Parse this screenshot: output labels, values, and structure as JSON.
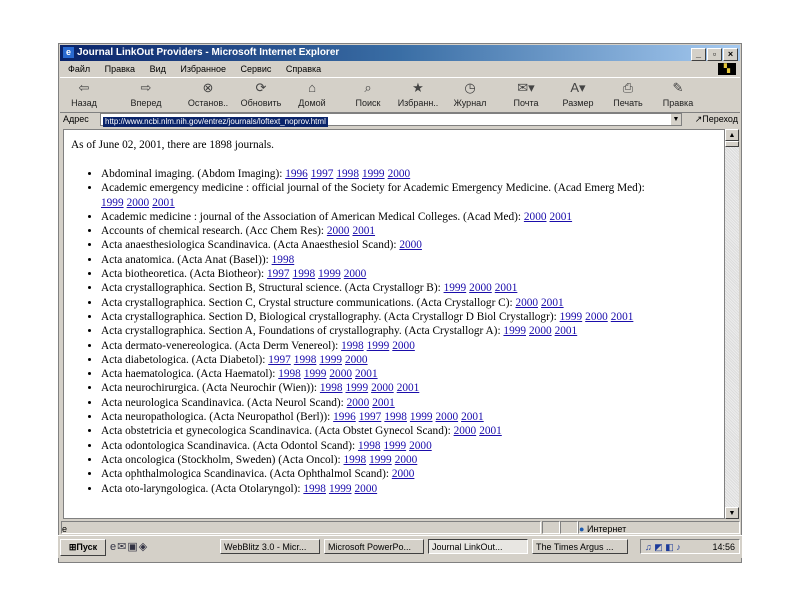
{
  "window": {
    "title": "Journal LinkOut Providers - Microsoft Internet Explorer"
  },
  "menu": [
    "Файл",
    "Правка",
    "Вид",
    "Избранное",
    "Сервис",
    "Справка"
  ],
  "toolbar": [
    {
      "label": "Назад",
      "icon": "back-arrow"
    },
    {
      "label": "Вперед",
      "icon": "forward-arrow"
    },
    {
      "label": "Останов..",
      "icon": "stop"
    },
    {
      "label": "Обновить",
      "icon": "refresh"
    },
    {
      "label": "Домой",
      "icon": "home"
    },
    {
      "label": "Поиск",
      "icon": "search"
    },
    {
      "label": "Избранн..",
      "icon": "favorites"
    },
    {
      "label": "Журнал",
      "icon": "history"
    },
    {
      "label": "Почта",
      "icon": "mail"
    },
    {
      "label": "Размер",
      "icon": "font-size"
    },
    {
      "label": "Печать",
      "icon": "print"
    },
    {
      "label": "Правка",
      "icon": "edit"
    }
  ],
  "address": {
    "label": "Адрес",
    "url": "http://www.ncbi.nlm.nih.gov/entrez/journals/loftext_noprov.html",
    "go": "Переход"
  },
  "page": {
    "intro": "As of June 02, 2001, there are 1898 journals.",
    "journals": [
      {
        "text": "Abdominal imaging. (Abdom Imaging):",
        "years": [
          "1996",
          "1997",
          "1998",
          "1999",
          "2000"
        ]
      },
      {
        "text": "Academic emergency medicine : official journal of the Society for Academic Emergency Medicine. (Acad Emerg Med):",
        "years": [
          "1999",
          "2000",
          "2001"
        ]
      },
      {
        "text": "Academic medicine : journal of the Association of American Medical Colleges. (Acad Med):",
        "years": [
          "2000",
          "2001"
        ]
      },
      {
        "text": "Accounts of chemical research. (Acc Chem Res):",
        "years": [
          "2000",
          "2001"
        ]
      },
      {
        "text": "Acta anaesthesiologica Scandinavica. (Acta Anaesthesiol Scand):",
        "years": [
          "2000"
        ]
      },
      {
        "text": "Acta anatomica. (Acta Anat (Basel)):",
        "years": [
          "1998"
        ]
      },
      {
        "text": "Acta biotheoretica. (Acta Biotheor):",
        "years": [
          "1997",
          "1998",
          "1999",
          "2000"
        ]
      },
      {
        "text": "Acta crystallographica. Section B, Structural science. (Acta Crystallogr B):",
        "years": [
          "1999",
          "2000",
          "2001"
        ]
      },
      {
        "text": "Acta crystallographica. Section C, Crystal structure communications. (Acta Crystallogr C):",
        "years": [
          "2000",
          "2001"
        ]
      },
      {
        "text": "Acta crystallographica. Section D, Biological crystallography. (Acta Crystallogr D Biol Crystallogr):",
        "years": [
          "1999",
          "2000",
          "2001"
        ]
      },
      {
        "text": "Acta crystallographica. Section A, Foundations of crystallography. (Acta Crystallogr A):",
        "years": [
          "1999",
          "2000",
          "2001"
        ]
      },
      {
        "text": "Acta dermato-venereologica. (Acta Derm Venereol):",
        "years": [
          "1998",
          "1999",
          "2000"
        ]
      },
      {
        "text": "Acta diabetologica. (Acta Diabetol):",
        "years": [
          "1997",
          "1998",
          "1999",
          "2000"
        ]
      },
      {
        "text": "Acta haematologica. (Acta Haematol):",
        "years": [
          "1998",
          "1999",
          "2000",
          "2001"
        ]
      },
      {
        "text": "Acta neurochirurgica. (Acta Neurochir (Wien)):",
        "years": [
          "1998",
          "1999",
          "2000",
          "2001"
        ]
      },
      {
        "text": "Acta neurologica Scandinavica. (Acta Neurol Scand):",
        "years": [
          "2000",
          "2001"
        ]
      },
      {
        "text": "Acta neuropathologica. (Acta Neuropathol (Berl)):",
        "years": [
          "1996",
          "1997",
          "1998",
          "1999",
          "2000",
          "2001"
        ]
      },
      {
        "text": "Acta obstetricia et gynecologica Scandinavica. (Acta Obstet Gynecol Scand):",
        "years": [
          "2000",
          "2001"
        ]
      },
      {
        "text": "Acta odontologica Scandinavica. (Acta Odontol Scand):",
        "years": [
          "1998",
          "1999",
          "2000"
        ]
      },
      {
        "text": "Acta oncologica (Stockholm, Sweden) (Acta Oncol):",
        "years": [
          "1998",
          "1999",
          "2000"
        ]
      },
      {
        "text": "Acta ophthalmologica Scandinavica. (Acta Ophthalmol Scand):",
        "years": [
          "2000"
        ]
      },
      {
        "text": "Acta oto-laryngologica. (Acta Otolaryngol):",
        "years": [
          "1998",
          "1999",
          "2000"
        ]
      }
    ]
  },
  "status": {
    "zone": "Интернет"
  },
  "taskbar": {
    "start": "Пуск",
    "tasks": [
      "WebBlitz 3.0 - Micr...",
      "Microsoft PowerPo...",
      "Journal LinkOut...",
      "The Times Argus ..."
    ],
    "time": "14:56"
  }
}
